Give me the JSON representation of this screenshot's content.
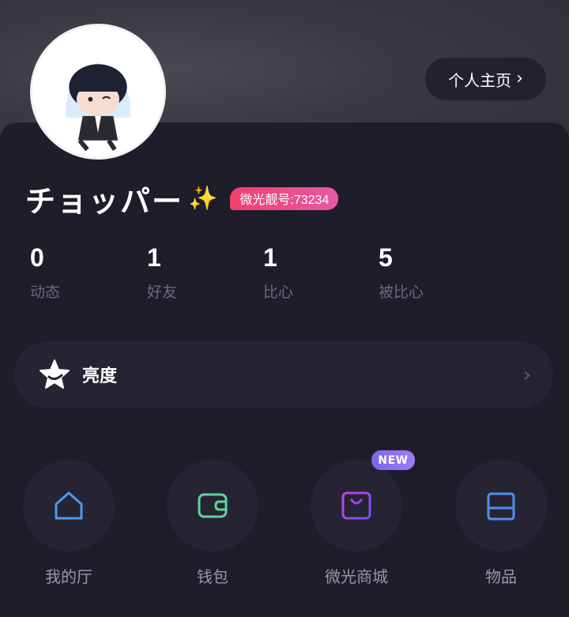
{
  "header": {
    "profile_button_label": "个人主页"
  },
  "user": {
    "name": "チョッパー",
    "name_emoji": "✨",
    "id_badge": "微光靓号:73234"
  },
  "stats": [
    {
      "value": "0",
      "label": "动态"
    },
    {
      "value": "1",
      "label": "好友"
    },
    {
      "value": "1",
      "label": "比心"
    },
    {
      "value": "5",
      "label": "被比心"
    }
  ],
  "brightness": {
    "label": "亮度",
    "icon": "star-icon"
  },
  "tiles": [
    {
      "label": "我的厅",
      "icon": "home-icon",
      "color": "#4c9cf0"
    },
    {
      "label": "钱包",
      "icon": "wallet-icon",
      "color": "#63d39a"
    },
    {
      "label": "微光商城",
      "icon": "shop-bag-icon",
      "color": "#a64de8",
      "badge": "NEW"
    },
    {
      "label": "物品",
      "icon": "storage-box-icon",
      "color": "#4d8ef5"
    }
  ],
  "colors": {
    "background": "#1f1d2a",
    "accent_pink": "#f0406b",
    "new_badge": "#8a6ff0"
  }
}
